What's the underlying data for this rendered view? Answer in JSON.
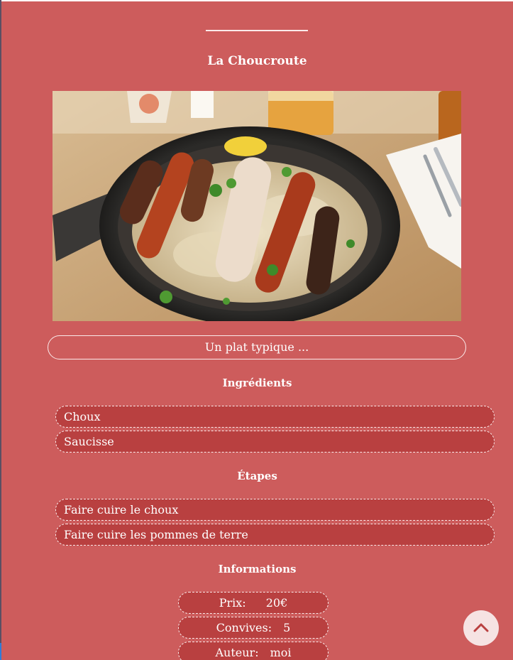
{
  "recipe": {
    "title": "La Choucroute",
    "image_alt": "Choucroute garnie dans une poêle",
    "description": "Un plat typique ..."
  },
  "ingredients": {
    "heading": "Ingrédients",
    "items": [
      "Choux",
      "Saucisse"
    ]
  },
  "steps": {
    "heading": "Étapes",
    "items": [
      "Faire cuire le choux",
      "Faire cuire les pommes de terre"
    ]
  },
  "informations": {
    "heading": "Informations",
    "price": {
      "label": "Prix:",
      "value": "20€"
    },
    "guests": {
      "label": "Convives:",
      "value": "5"
    },
    "author": {
      "label": "Auteur:",
      "value": "moi"
    }
  },
  "icons": {
    "scroll_top": "chevron-up-icon"
  },
  "colors": {
    "background": "#cd5c5c",
    "pill_background": "#b94040",
    "border": "#fbeaea",
    "scroll_button": "#f6e3e3"
  }
}
